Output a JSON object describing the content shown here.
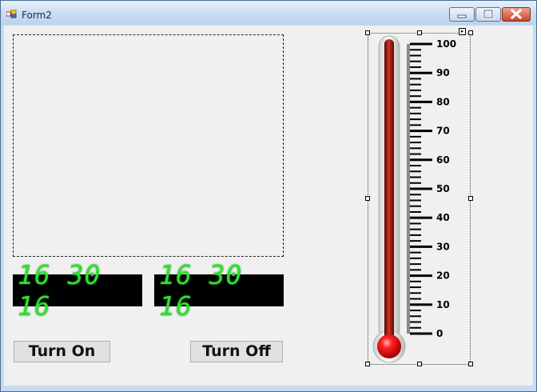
{
  "window": {
    "title": "Form2"
  },
  "clocks": [
    {
      "time": "16 30 16"
    },
    {
      "time": "16 30 16"
    }
  ],
  "buttons": {
    "turn_on": "Turn On",
    "turn_off": "Turn Off"
  },
  "thermometer": {
    "ticks": [
      "100",
      "90",
      "80",
      "70",
      "60",
      "50",
      "40",
      "30",
      "20",
      "10",
      "0"
    ],
    "value": 100,
    "min": 0,
    "max": 100
  }
}
